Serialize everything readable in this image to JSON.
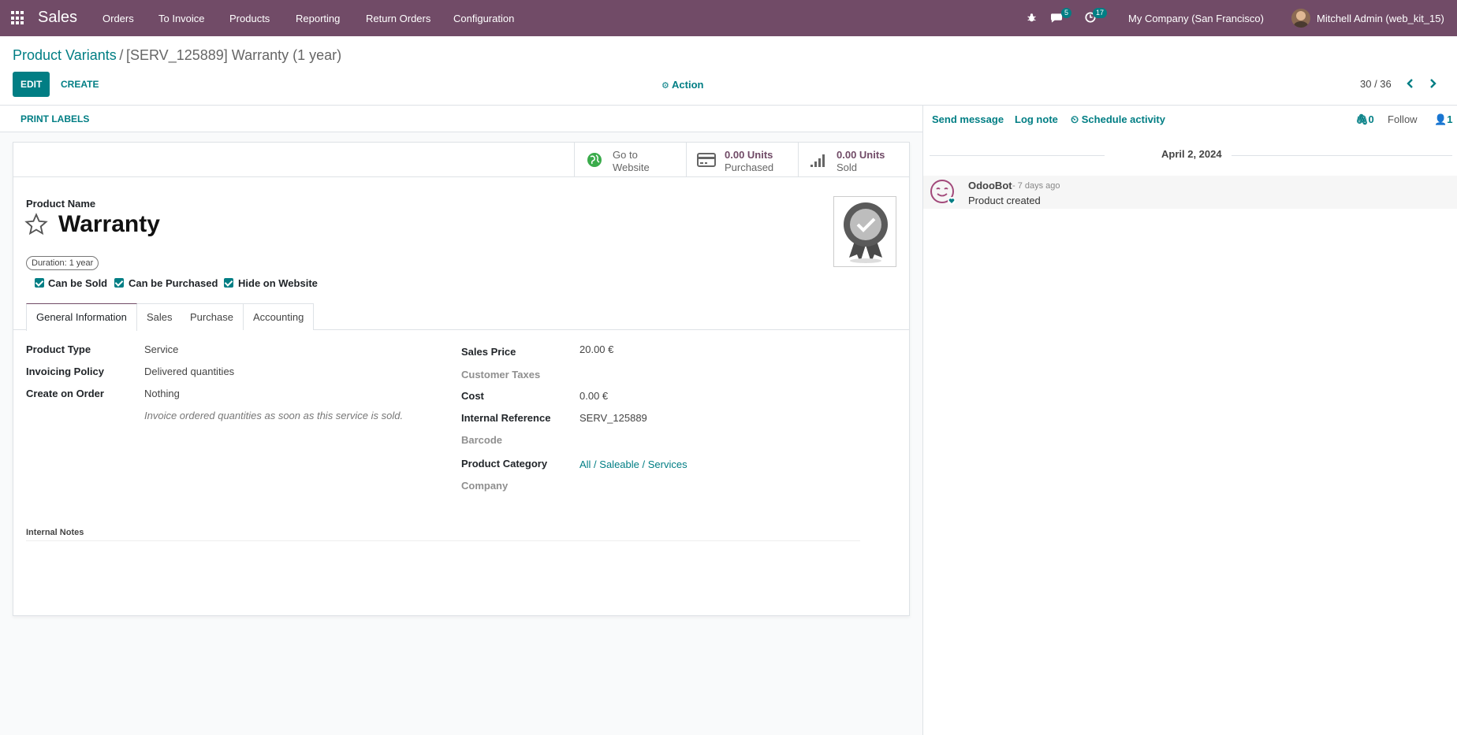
{
  "navbar": {
    "app_name": "Sales",
    "menu": [
      "Orders",
      "To Invoice",
      "Products",
      "Reporting",
      "Return Orders",
      "Configuration"
    ],
    "messages_count": "5",
    "activities_count": "17",
    "company": "My Company (San Francisco)",
    "user": "Mitchell Admin (web_kit_15)"
  },
  "breadcrumb": {
    "parent": "Product Variants",
    "separator": "/",
    "current": "[SERV_125889] Warranty (1 year)"
  },
  "toolbar": {
    "edit": "EDIT",
    "create": "CREATE",
    "action": "Action",
    "pager": "30 / 36"
  },
  "statusbar": {
    "print_labels": "PRINT LABELS"
  },
  "smart_buttons": {
    "website_l1": "Go to",
    "website_l2": "Website",
    "purchased_value": "0.00 Units",
    "purchased_label": "Purchased",
    "sold_value": "0.00 Units",
    "sold_label": "Sold"
  },
  "product": {
    "name_label": "Product Name",
    "name": "Warranty",
    "variant_tag": "Duration: 1 year",
    "can_be_sold": "Can be Sold",
    "can_be_purchased": "Can be Purchased",
    "hide_on_website": "Hide on Website"
  },
  "tabs": [
    "General Information",
    "Sales",
    "Purchase",
    "Accounting"
  ],
  "general": {
    "product_type_label": "Product Type",
    "product_type": "Service",
    "invoicing_policy_label": "Invoicing Policy",
    "invoicing_policy": "Delivered quantities",
    "create_on_order_label": "Create on Order",
    "create_on_order": "Nothing",
    "help_text": "Invoice ordered quantities as soon as this service is sold.",
    "sales_price_label": "Sales Price",
    "sales_price": "20.00 €",
    "customer_taxes_label": "Customer Taxes",
    "cost_label": "Cost",
    "cost": "0.00 €",
    "internal_ref_label": "Internal Reference",
    "internal_ref": "SERV_125889",
    "barcode_label": "Barcode",
    "category_label": "Product Category",
    "category": "All / Saleable / Services",
    "company_label": "Company",
    "internal_notes_label": "Internal Notes"
  },
  "chatter": {
    "send_message": "Send message",
    "log_note": "Log note",
    "schedule_activity": "Schedule activity",
    "attachments": "0",
    "follow": "Follow",
    "followers": "1",
    "date": "April 2, 2024",
    "author": "OdooBot",
    "time": "- 7 days ago",
    "message": "Product created"
  },
  "colors": {
    "brand": "#714B67",
    "accent": "#017e84"
  }
}
